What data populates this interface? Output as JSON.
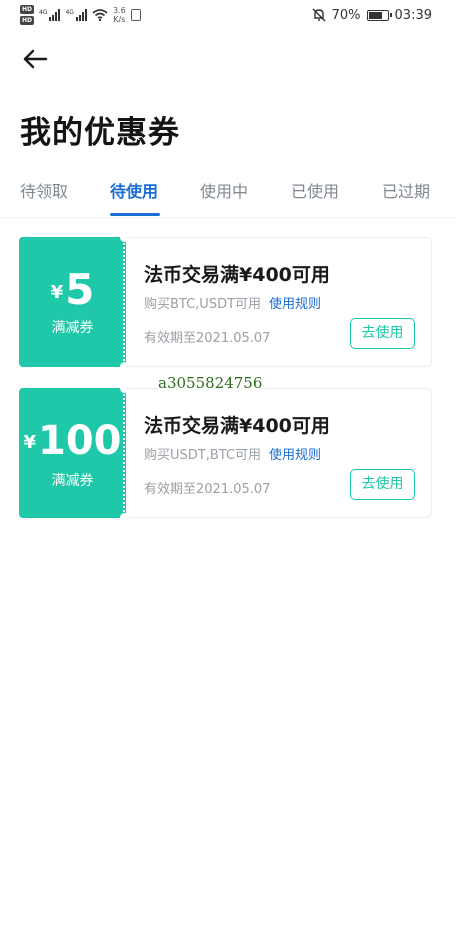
{
  "status_bar": {
    "hd1": "HD",
    "hd2": "HD",
    "signal1_label": "4G",
    "signal2_label": "4G",
    "net_speed_value": "3.6",
    "net_speed_unit": "K/s",
    "battery_percent": "70%",
    "time": "03:39"
  },
  "header": {
    "back_icon": "arrow-left-icon",
    "title": "我的优惠券"
  },
  "tabs": [
    {
      "label": "待领取",
      "active": false
    },
    {
      "label": "待使用",
      "active": true
    },
    {
      "label": "使用中",
      "active": false
    },
    {
      "label": "已使用",
      "active": false
    },
    {
      "label": "已过期",
      "active": false
    }
  ],
  "coupons": [
    {
      "currency": "¥",
      "amount": "5",
      "type": "满减券",
      "title": "法币交易满¥400可用",
      "desc": "购买BTC,USDT可用",
      "rules_label": "使用规则",
      "validity": "有效期至2021.05.07",
      "button_label": "去使用"
    },
    {
      "currency": "¥",
      "amount": "100",
      "type": "满减券",
      "title": "法币交易满¥400可用",
      "desc": "购买USDT,BTC可用",
      "rules_label": "使用规则",
      "validity": "有效期至2021.05.07",
      "button_label": "去使用"
    }
  ],
  "watermark": "a3055824756",
  "colors": {
    "accent": "#1a6cd6",
    "coupon_green": "#1ec8a8"
  }
}
